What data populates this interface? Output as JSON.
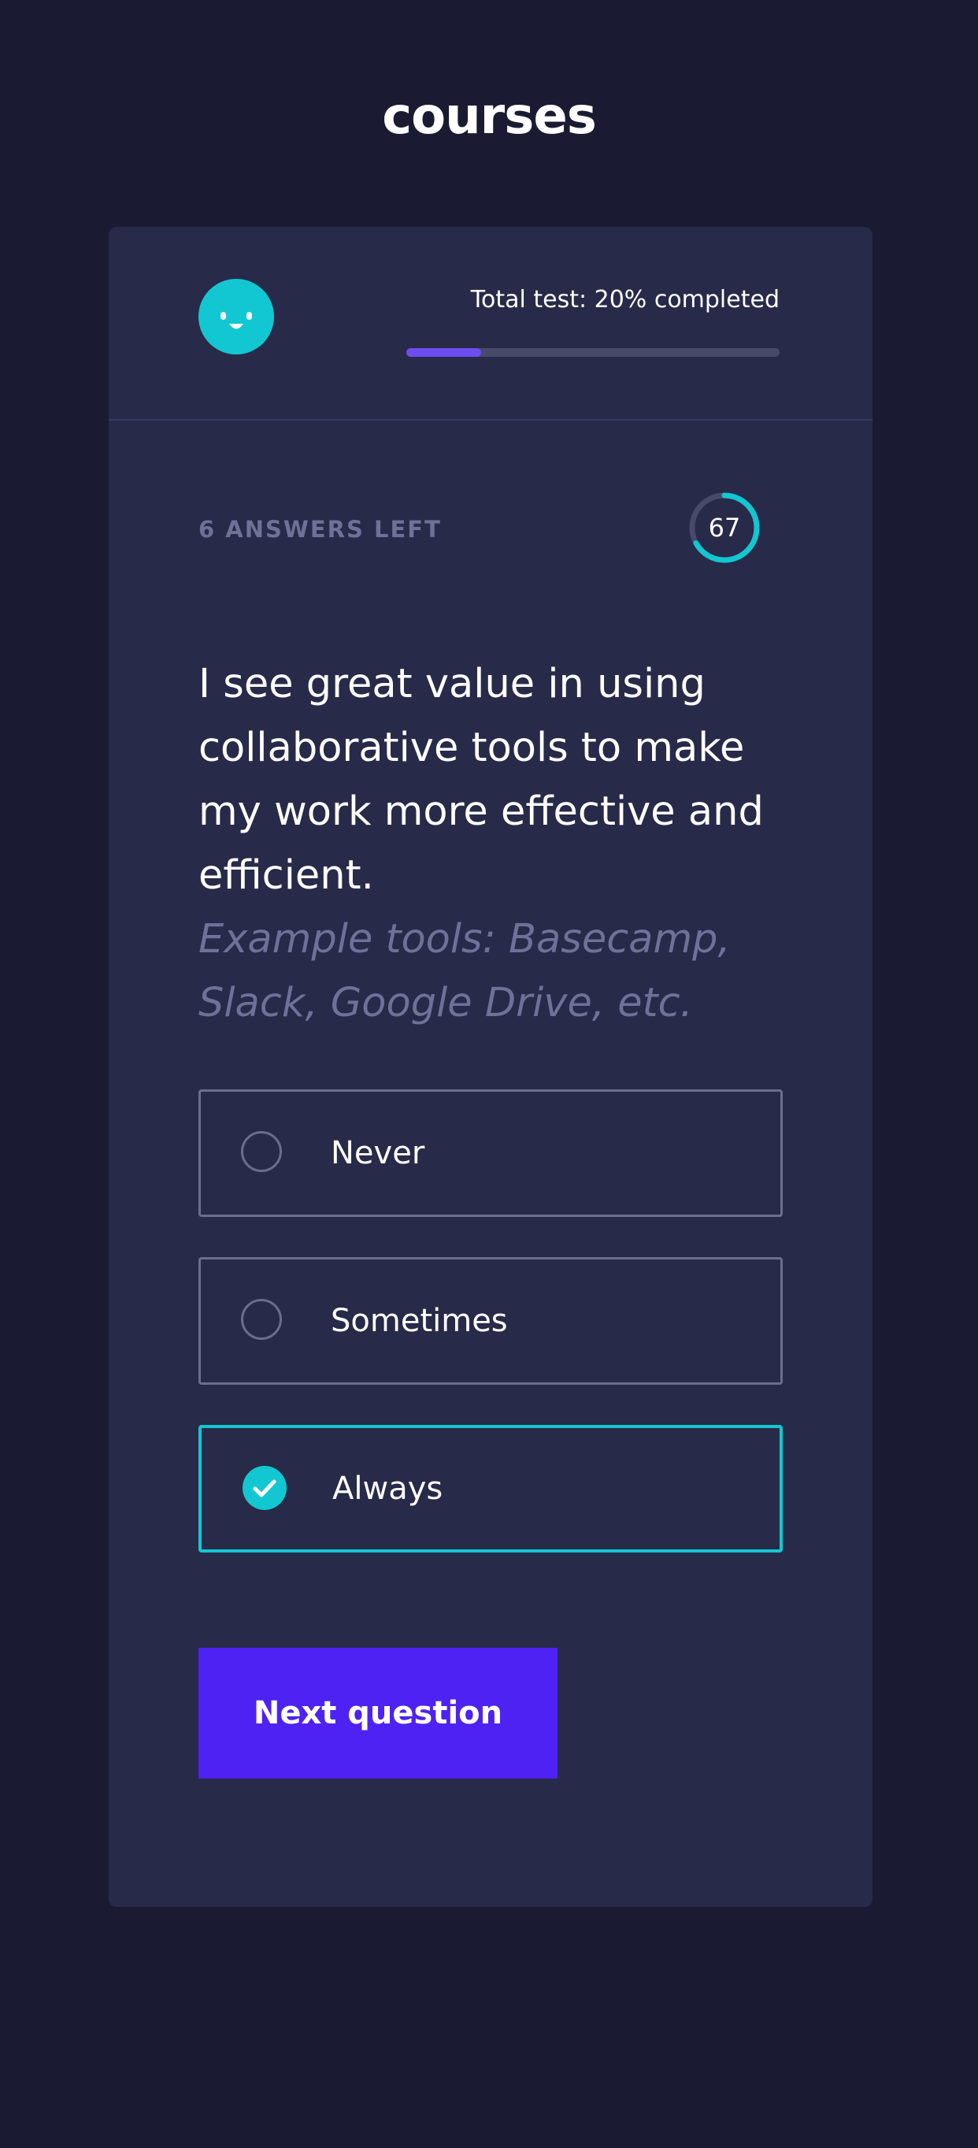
{
  "header": {
    "brand": "courses"
  },
  "progress": {
    "label": "Total test: 20% completed",
    "value": 0.2,
    "fill_color": "#6d4df2"
  },
  "quiz": {
    "answers_left": "6 ANSWERS LEFT",
    "timer_value": "67",
    "timer_progress": 0.67,
    "question": "I see great value in using collaborative tools to make my work more effective and efficient.",
    "hint": "Example tools: Basecamp, Slack, Google Drive, etc.",
    "options": [
      {
        "label": "Never",
        "selected": false
      },
      {
        "label": "Sometimes",
        "selected": false
      },
      {
        "label": "Always",
        "selected": true
      }
    ],
    "next_label": "Next question"
  },
  "colors": {
    "background": "#1a1b33",
    "card": "#272a48",
    "accent": "#12c7d2",
    "button": "#4e22f2",
    "muted_text": "#6e7198"
  },
  "icons": {
    "avatar": "smiley-face-icon",
    "selected_option": "checkmark-icon"
  }
}
